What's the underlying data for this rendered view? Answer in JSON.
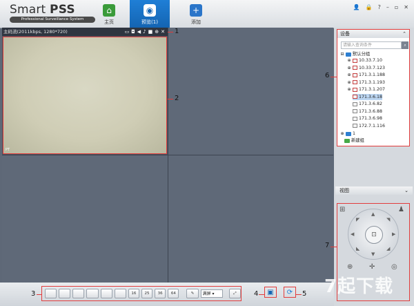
{
  "app": {
    "title_plain": "Smart ",
    "title_bold": "PSS",
    "subtitle": "Professional Surveillance System"
  },
  "nav": {
    "home": {
      "label": "主页",
      "icon": "home-icon"
    },
    "preview": {
      "label": "预览(1)",
      "icon": "camera-icon"
    },
    "add": {
      "label": "添加",
      "icon": "plus-icon"
    }
  },
  "window_controls": [
    "user-icon",
    "lock-icon",
    "help-icon",
    "minimize-icon",
    "maximize-icon",
    "close-icon"
  ],
  "stream": {
    "label": "主码流(2011kbps, 1280*720)",
    "tools": [
      "layout-icon",
      "snapshot-icon",
      "audio-icon",
      "microphone-icon",
      "record-icon",
      "zoom-icon",
      "close-icon"
    ],
    "feed_tag": "PT"
  },
  "markers": {
    "m1": "1",
    "m2": "2",
    "m3": "3",
    "m4": "4",
    "m5": "5",
    "m6": "6",
    "m7": "7"
  },
  "toolbar": {
    "layout_buttons": [
      "",
      "",
      "",
      "",
      "",
      "",
      "16",
      "25",
      "36",
      "64"
    ],
    "screen_select": "满屏",
    "fullscreen_icon": "fullscreen-icon",
    "save_icon": "save-icon",
    "refresh_icon": "refresh-icon"
  },
  "device_panel": {
    "title": "设备",
    "search_placeholder": "请输入查询条件",
    "group_root": "默认分组",
    "devices": [
      {
        "ip": "10.33.7.10",
        "online": true,
        "selected": false
      },
      {
        "ip": "10.33.7.123",
        "online": true,
        "selected": false
      },
      {
        "ip": "171.3.1.188",
        "online": true,
        "selected": false
      },
      {
        "ip": "171.3.1.193",
        "online": true,
        "selected": false
      },
      {
        "ip": "171.3.1.207",
        "online": true,
        "selected": false
      },
      {
        "ip": "171.3.6.18",
        "online": true,
        "selected": true
      },
      {
        "ip": "171.3.6.82",
        "online": false,
        "selected": false
      },
      {
        "ip": "171.3.6.88",
        "online": false,
        "selected": false
      },
      {
        "ip": "171.3.6.98",
        "online": false,
        "selected": false
      },
      {
        "ip": "172.7.1.116",
        "online": false,
        "selected": false
      }
    ],
    "group_2": "1",
    "new_group": "新建组"
  },
  "view_panel": {
    "title": "视图"
  },
  "watermark": "7起下载",
  "colors": {
    "accent": "#1f7fd6",
    "annotation": "#e23b3b"
  }
}
